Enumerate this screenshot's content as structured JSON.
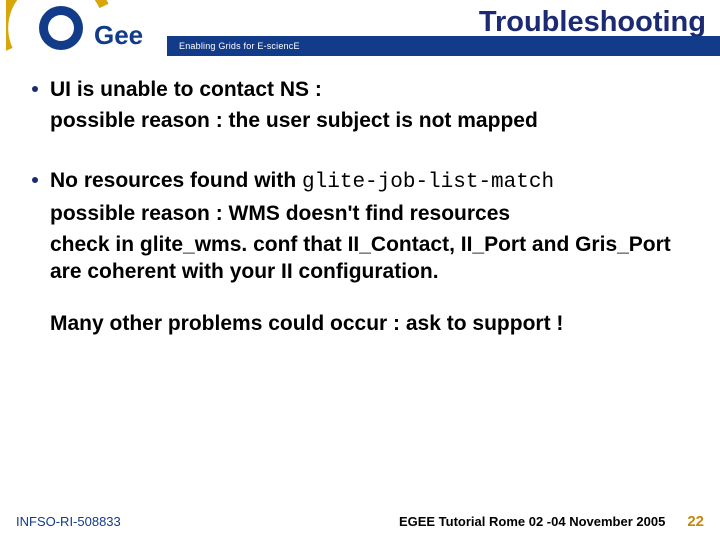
{
  "header": {
    "title": "Troubleshooting",
    "tagline": "Enabling Grids for E-sciencE",
    "logo_alt": "EGEE"
  },
  "content": {
    "b1_line1": "UI is unable to contact NS :",
    "b1_line2": "possible reason : the user subject is not mapped",
    "b2_prefix": "No resources found with ",
    "b2_code": "glite-job-list-match",
    "b2_line2": "possible reason : WMS doesn't find resources",
    "b2_line3": "check in glite_wms. conf that II_Contact, II_Port and Gris_Port are coherent with your II configuration.",
    "closing": "Many other problems could occur : ask to support !"
  },
  "footer": {
    "left": "INFSO-RI-508833",
    "mid": "EGEE Tutorial Rome 02 -04 November 2005",
    "num": "22"
  }
}
